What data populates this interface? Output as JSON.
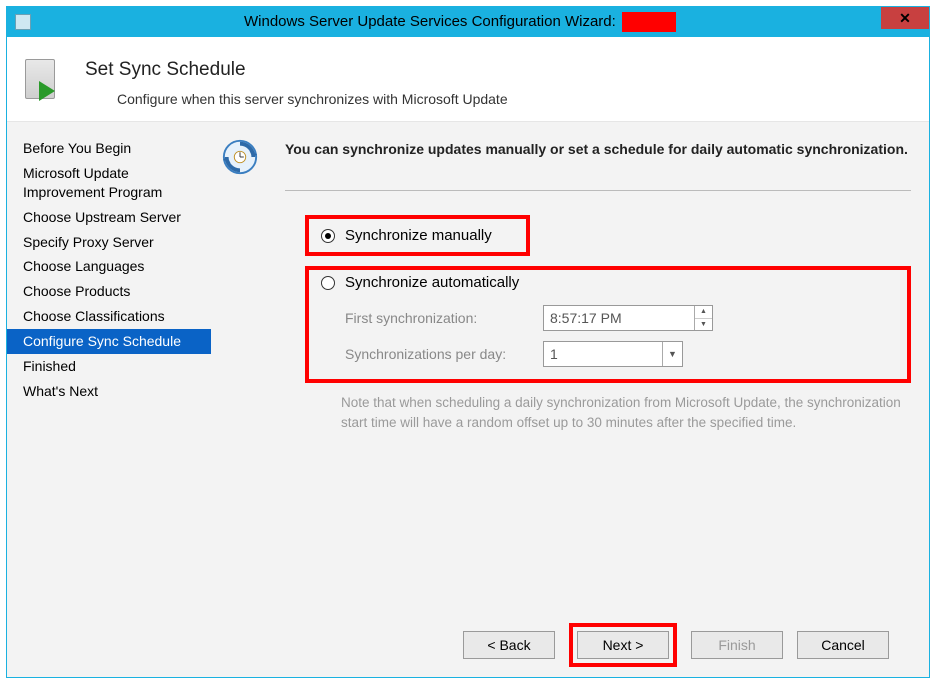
{
  "window": {
    "title_prefix": "Windows Server Update Services Configuration Wizard:"
  },
  "header": {
    "title": "Set Sync Schedule",
    "subtitle": "Configure when this server synchronizes with Microsoft Update"
  },
  "sidebar": {
    "items": [
      {
        "label": "Before You Begin",
        "selected": false
      },
      {
        "label": "Microsoft Update\nImprovement Program",
        "selected": false
      },
      {
        "label": "Choose Upstream Server",
        "selected": false
      },
      {
        "label": "Specify Proxy Server",
        "selected": false
      },
      {
        "label": "Choose Languages",
        "selected": false
      },
      {
        "label": "Choose Products",
        "selected": false
      },
      {
        "label": "Choose Classifications",
        "selected": false
      },
      {
        "label": "Configure Sync Schedule",
        "selected": true
      },
      {
        "label": "Finished",
        "selected": false
      },
      {
        "label": "What's Next",
        "selected": false
      }
    ]
  },
  "main": {
    "intro": "You can synchronize updates manually or set a schedule for daily automatic synchronization.",
    "radio_manual": "Synchronize manually",
    "radio_auto": "Synchronize automatically",
    "first_sync_label": "First synchronization:",
    "first_sync_value": "8:57:17 PM",
    "per_day_label": "Synchronizations per day:",
    "per_day_value": "1",
    "note": "Note that when scheduling a daily synchronization from Microsoft Update, the synchronization start time will have a random offset up to 30 minutes after the specified time.",
    "selected_radio": "manual"
  },
  "footer": {
    "back": "< Back",
    "next": "Next >",
    "finish": "Finish",
    "cancel": "Cancel"
  }
}
